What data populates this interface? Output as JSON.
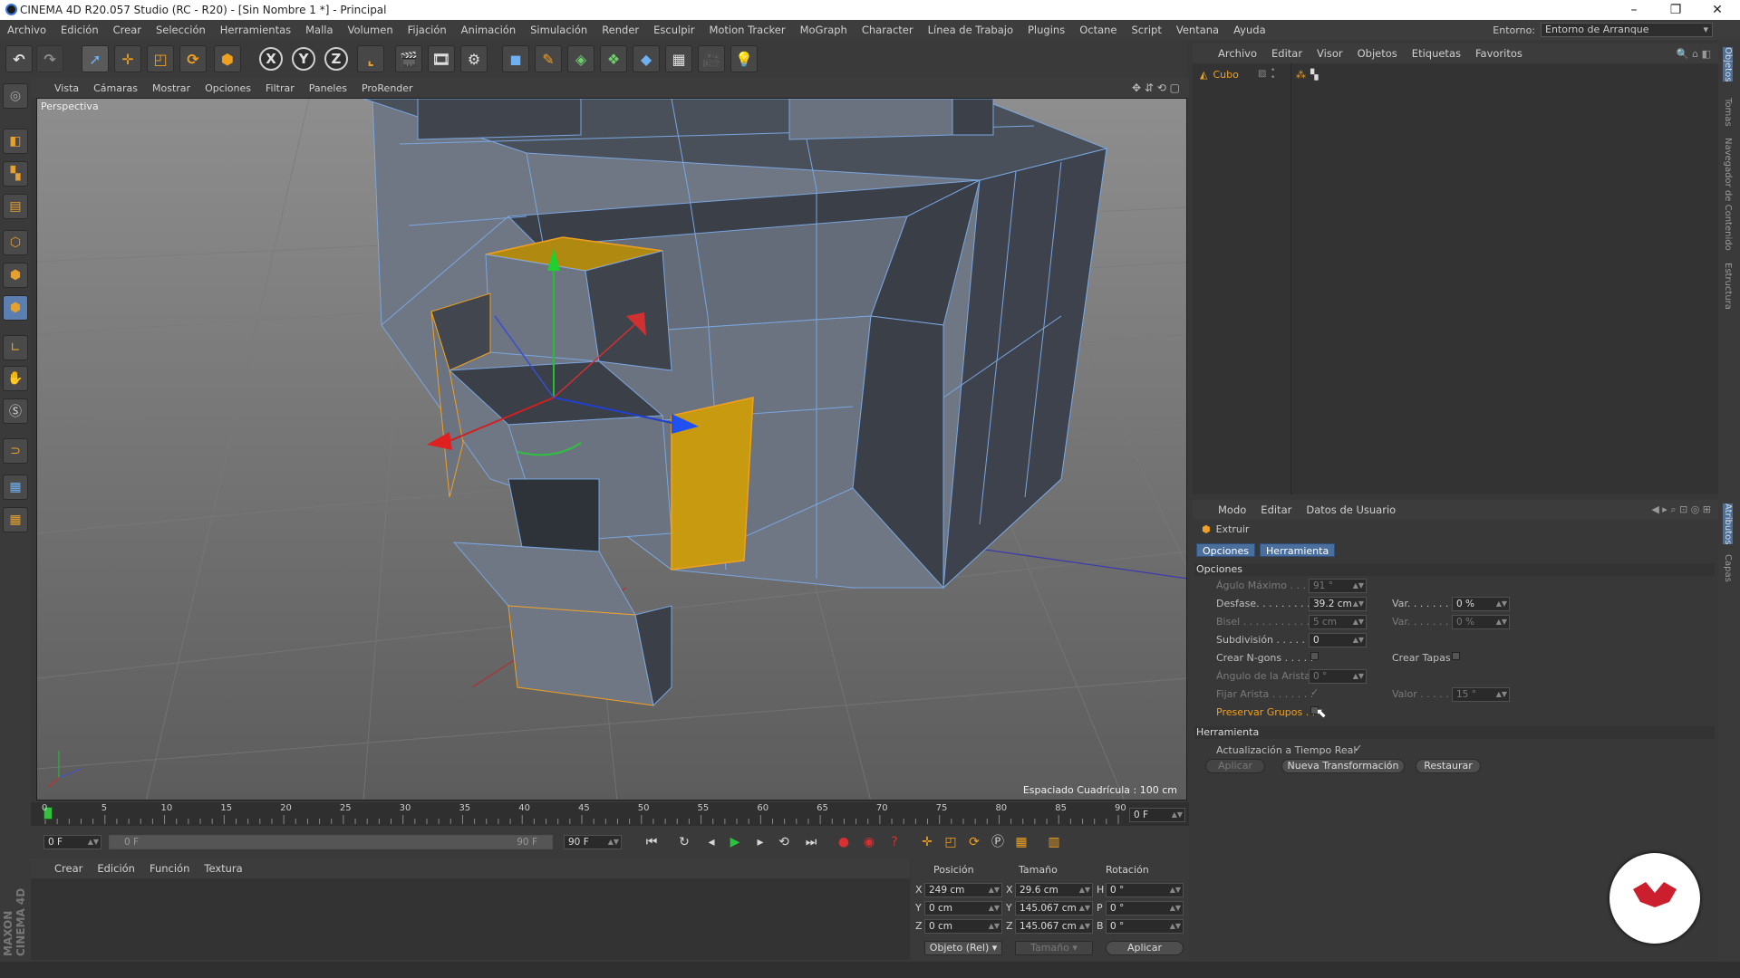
{
  "window": {
    "title": "CINEMA 4D R20.057 Studio (RC - R20) - [Sin Nombre 1 *] - Principal",
    "minimize": "–",
    "restore": "❐",
    "close": "✕"
  },
  "menubar": {
    "items": [
      "Archivo",
      "Edición",
      "Crear",
      "Selección",
      "Herramientas",
      "Malla",
      "Volumen",
      "Fijación",
      "Animación",
      "Simulación",
      "Render",
      "Esculpir",
      "Motion Tracker",
      "MoGraph",
      "Character",
      "Línea de Trabajo",
      "Plugins",
      "Octane",
      "Script",
      "Ventana",
      "Ayuda"
    ],
    "env_label": "Entorno:",
    "env_value": "Entorno de Arranque"
  },
  "toolbar": {
    "axis_x": "X",
    "axis_y": "Y",
    "axis_z": "Z"
  },
  "viewport": {
    "menu": [
      "Vista",
      "Cámaras",
      "Mostrar",
      "Opciones",
      "Filtrar",
      "Paneles",
      "ProRender"
    ],
    "label": "Perspectiva",
    "grid_spacing": "Espaciado Cuadrícula : 100 cm"
  },
  "timeline": {
    "ticks": [
      "0",
      "5",
      "10",
      "15",
      "20",
      "25",
      "30",
      "35",
      "40",
      "45",
      "50",
      "55",
      "60",
      "65",
      "70",
      "75",
      "80",
      "85",
      "90"
    ],
    "current_frame": "0 F",
    "start_field": "0 F",
    "range_start": "0 F",
    "range_end": "90 F",
    "end_field": "90 F"
  },
  "materials": {
    "menu": [
      "Crear",
      "Edición",
      "Función",
      "Textura"
    ]
  },
  "coords": {
    "headers": [
      "Posición",
      "Tamaño",
      "Rotación"
    ],
    "rows": [
      {
        "axis": "X",
        "pos": "249 cm",
        "size_axis": "X",
        "size": "29.6 cm",
        "rot_axis": "H",
        "rot": "0 °"
      },
      {
        "axis": "Y",
        "pos": "0 cm",
        "size_axis": "Y",
        "size": "145.067 cm",
        "rot_axis": "P",
        "rot": "0 °"
      },
      {
        "axis": "Z",
        "pos": "0 cm",
        "size_axis": "Z",
        "size": "145.067 cm",
        "rot_axis": "B",
        "rot": "0 °"
      }
    ],
    "mode": "Objeto (Rel)",
    "size_mode": "Tamaño",
    "apply": "Aplicar"
  },
  "objects": {
    "menu": [
      "Archivo",
      "Editar",
      "Visor",
      "Objetos",
      "Etiquetas",
      "Favoritos"
    ],
    "items": [
      {
        "name": "Cubo"
      }
    ]
  },
  "attributes": {
    "menu": [
      "Modo",
      "Editar",
      "Datos de Usuario"
    ],
    "tool_name": "Extruir",
    "tabs": [
      "Opciones",
      "Herramienta"
    ],
    "section_options": "Opciones",
    "fields": {
      "angulo_max": {
        "label": "Águlo Máximo . . . .",
        "value": "91 °"
      },
      "desfase": {
        "label": "Desfase. . . . . . . . .",
        "value": "39.2 cm"
      },
      "var1": {
        "label": "Var. . . . . . .",
        "value": "0 %"
      },
      "bisel": {
        "label": "Bisel . . . . . . . . . . .",
        "value": "5 cm"
      },
      "var2": {
        "label": "Var. . . . . . .",
        "value": "0 %"
      },
      "subdivision": {
        "label": "Subdivisión . . . . .",
        "value": "0"
      },
      "crear_ngons": {
        "label": "Crear N-gons . . . . ."
      },
      "crear_tapas": {
        "label": "Crear Tapas"
      },
      "angulo_arista": {
        "label": "Ángulo de la Arista",
        "value": "0 °"
      },
      "fijar_arista": {
        "label": "Fijar Arista . . . . . . .",
        "check": "✓"
      },
      "valor": {
        "label": "Valor . . . . .",
        "value": "15 °"
      },
      "preservar": {
        "label": "Preservar Grupos . ."
      }
    },
    "section_tool": "Herramienta",
    "realtime": {
      "label": "Actualización a Tiempo Real",
      "check": "✓"
    },
    "buttons": {
      "apply": "Aplicar",
      "new": "Nueva Transformación",
      "reset": "Restaurar"
    }
  },
  "right_tabs": [
    "Objetos",
    "Tomas",
    "Navegador de Contenido",
    "Estructura",
    "Atributos",
    "Capas"
  ],
  "branding": {
    "maxon": "MAXON CINEMA 4D"
  },
  "colors": {
    "selection": "#f0a020",
    "accent": "#4a6f9c",
    "brand": "#cc1f2d"
  }
}
